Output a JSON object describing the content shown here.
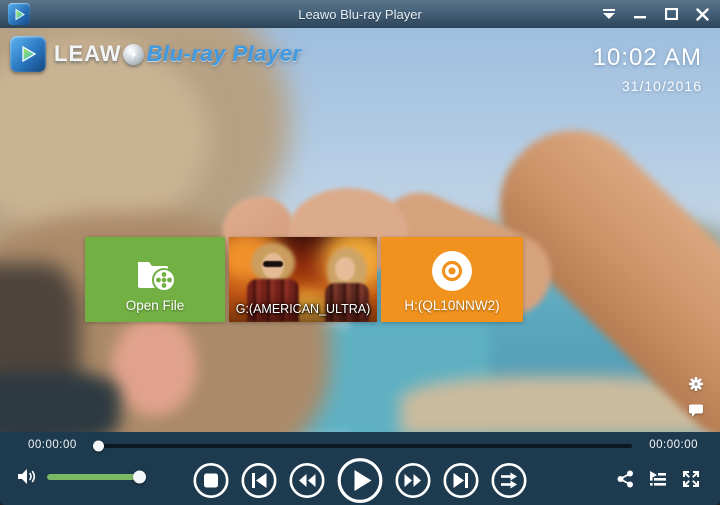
{
  "window": {
    "title": "Leawo Blu-ray Player"
  },
  "logo": {
    "brand": "LEAWO",
    "brand_prefix": "LEAW",
    "product": "Blu-ray Player"
  },
  "clock": {
    "time": "10:02 AM",
    "date": "31/10/2016"
  },
  "tiles": [
    {
      "id": "open-file",
      "label": "Open File",
      "color": "#72b043"
    },
    {
      "id": "drive-g",
      "label": "G:(AMERICAN_ULTRA)",
      "kind": "movie-poster"
    },
    {
      "id": "drive-h",
      "label": "H:(QL10NNW2)",
      "color": "#f0921d"
    }
  ],
  "player": {
    "elapsed": "00:00:00",
    "duration": "00:00:00",
    "progress_pct": 1,
    "volume_pct": 95
  },
  "colors": {
    "titlebar_top": "#5a7487",
    "titlebar_bottom": "#2c4458",
    "controlbar": "#1d3a4e",
    "accent_green": "#72b043",
    "accent_orange": "#f0921d",
    "volume_green": "#7cb964",
    "logo_blue": "#3f9ae2"
  },
  "icons": {
    "app-icon": "leawo-play-folder",
    "menu-dropdown-icon": "bar-over-triangle-down",
    "minimize-icon": "—",
    "maximize-icon": "□",
    "close-icon": "✕",
    "open-file-icon": "folder-with-film-reel",
    "disc-icon": "optical-disc",
    "settings-gear-icon": "gear",
    "message-icon": "speech-bubble",
    "volume-icon": "speaker",
    "stop-icon": "■",
    "previous-icon": "|◀",
    "rewind-icon": "◀◀",
    "play-icon": "▶",
    "fast-forward-icon": "▶▶",
    "next-icon": "▶|",
    "play-order-icon": "⇉",
    "share-icon": "share-nodes",
    "playlist-icon": "play-list",
    "fullscreen-icon": "expand-arrows"
  }
}
